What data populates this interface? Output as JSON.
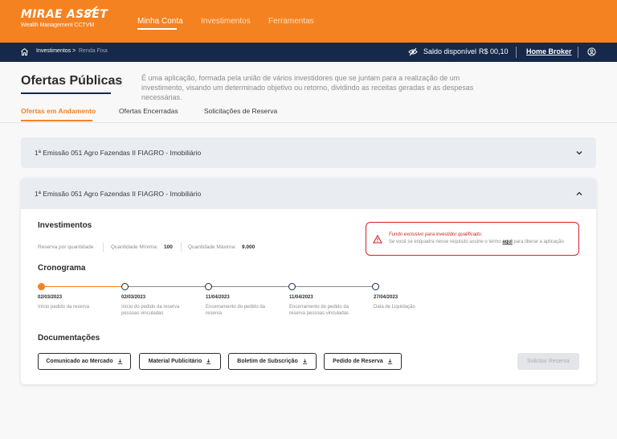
{
  "brand": {
    "name": "MIRAE ASSET",
    "sub": "Wealth Management CCTVM"
  },
  "topnav": [
    {
      "label": "Minha Conta",
      "active": true
    },
    {
      "label": "Investimentos",
      "active": false
    },
    {
      "label": "Ferramentas",
      "active": false
    }
  ],
  "subbar": {
    "breadcrumb": [
      "Investimentos >",
      "Renda Fixa"
    ],
    "saldo_label": "Saldo disponível",
    "saldo_value": "R$ 00,10",
    "home_broker": "Home Broker"
  },
  "page": {
    "title": "Ofertas Públicas",
    "description": "É uma aplicação, formada pela união de vários investidores que se juntam para a realização de um investimento, visando um determinado objetivo ou retorno, dividindo as receitas geradas e as despesas necessárias."
  },
  "tabs": [
    {
      "label": "Ofertas em Andamento",
      "active": true
    },
    {
      "label": "Ofertas Encerradas",
      "active": false
    },
    {
      "label": "Solicitações de Reserva",
      "active": false
    }
  ],
  "offers": [
    {
      "title": "1ª Emissão 051 Agro Fazendas II FIAGRO - Imobiliário",
      "expanded": false
    },
    {
      "title": "1ª Emissão 051 Agro Fazendas II FIAGRO - Imobiliário",
      "expanded": true
    }
  ],
  "investimentos": {
    "title": "Investimentos",
    "reserva": "Reserva por quantidade",
    "min_label": "Quantidade Mínima:",
    "min_value": "100",
    "max_label": "Quantidade Máxima:",
    "max_value": "9.000"
  },
  "alert": {
    "title": "Fundo exclusivo para investidor qualificado.",
    "text_before": "Se você se enquadra nesse requisito assine o termo ",
    "link": "aqui",
    "text_after": " para liberar a aplicação"
  },
  "cronograma": {
    "title": "Cronograma",
    "steps": [
      {
        "date": "02/03/2023",
        "desc": "Início pedido da reserva",
        "done": true
      },
      {
        "date": "02/03/2023",
        "desc": "Início do pedido da reserva pessoas vinculadas",
        "done": false
      },
      {
        "date": "11/04/2023",
        "desc": "Encerramento do pedido da reserva",
        "done": false
      },
      {
        "date": "11/04/2023",
        "desc": "Encerramento do pedido da reserva pessoas vinculadas",
        "done": false
      },
      {
        "date": "27/04/2023",
        "desc": "Data de Liquidação",
        "done": false
      }
    ]
  },
  "documentacoes": {
    "title": "Documentações",
    "buttons": [
      "Comunicado ao Mercado",
      "Material Publicitário",
      "Boletim de Subscrição",
      "Pedido de Reserva"
    ]
  },
  "solicitar_label": "Solicitar Reserva",
  "colors": {
    "brand_orange": "#f58220",
    "navy": "#16294a",
    "alert_red": "#d0242b"
  }
}
